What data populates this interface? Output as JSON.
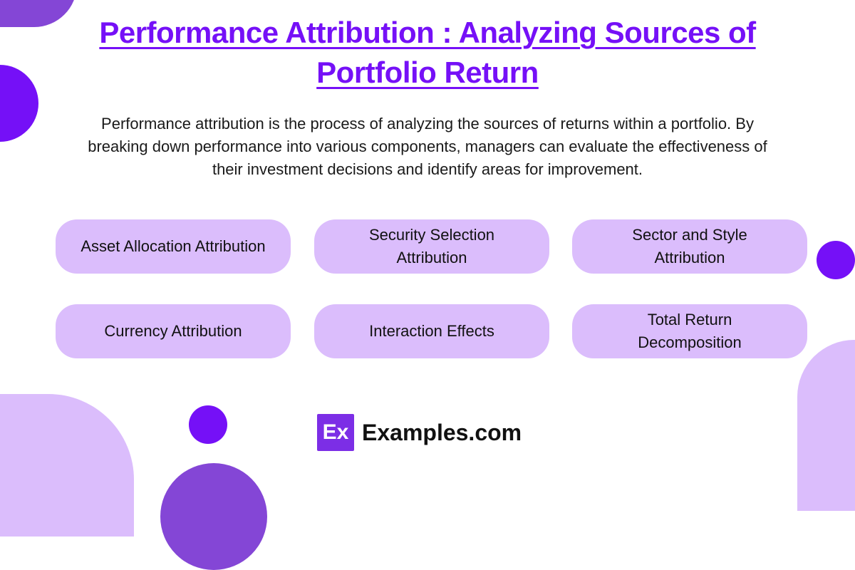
{
  "title": "Performance Attribution : Analyzing Sources of Portfolio Return",
  "description": "Performance attribution is the process of analyzing the sources of returns within a portfolio. By breaking down performance into various components, managers can evaluate the effectiveness of their investment decisions and identify areas for improvement.",
  "cards": [
    {
      "label": "Asset Allocation Attribution"
    },
    {
      "label": "Security Selection Attribution"
    },
    {
      "label": "Sector and Style Attribution"
    },
    {
      "label": "Currency Attribution"
    },
    {
      "label": "Interaction Effects"
    },
    {
      "label": "Total Return Decomposition"
    }
  ],
  "logo": {
    "mark": "Ex",
    "text": "Examples.com"
  },
  "colors": {
    "accent": "#7510f7",
    "card": "#dbbdfc",
    "shape_dark": "#8446d6"
  }
}
